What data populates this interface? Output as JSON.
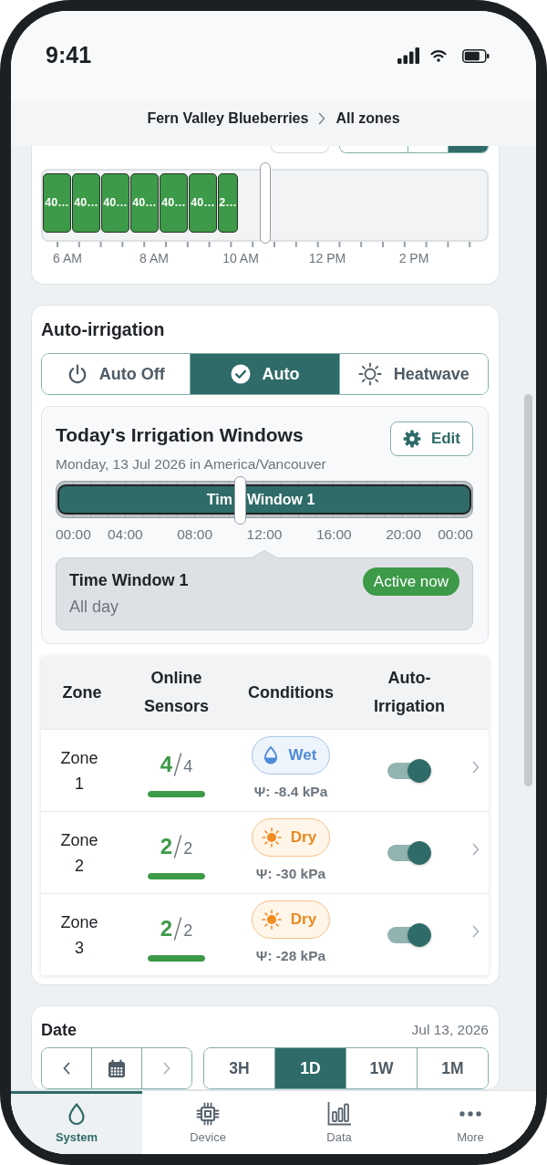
{
  "status_bar": {
    "time": "9:41"
  },
  "breadcrumb": {
    "items": [
      "Fern Valley Blueberries",
      "All zones"
    ]
  },
  "usage_timeline": {
    "range_buttons": [
      {
        "selected": false
      },
      {
        "selected": false
      },
      {
        "selected": true
      }
    ],
    "blocks": [
      {
        "label": "40…"
      },
      {
        "label": "40…"
      },
      {
        "label": "40…"
      },
      {
        "label": "40…"
      },
      {
        "label": "40…"
      },
      {
        "label": "40…"
      },
      {
        "label": "2…"
      }
    ],
    "marker": {
      "level": 0.5
    },
    "axis_labels": [
      "6 AM",
      "8 AM",
      "10 AM",
      "12 PM",
      "2 PM"
    ]
  },
  "auto_irrigation": {
    "title": "Auto-irrigation",
    "modes": [
      {
        "kind": "off",
        "label": "Auto Off",
        "selected": false
      },
      {
        "kind": "auto",
        "label": "Auto",
        "selected": true
      },
      {
        "kind": "heatwave",
        "label": "Heatwave",
        "selected": false
      }
    ],
    "windows": {
      "title": "Today's Irrigation Windows",
      "edit_label": "Edit",
      "date_line": "Monday, 13 Jul 2026 in America/Vancouver",
      "bar_label_parts": [
        "Tim",
        "Window 1"
      ],
      "marker": {
        "level": 0.442
      },
      "axis_labels": [
        "00:00",
        "04:00",
        "08:00",
        "12:00",
        "16:00",
        "20:00",
        "00:00"
      ],
      "popover": {
        "title": "Time Window 1",
        "detail": "All day",
        "badge": "Active now"
      }
    },
    "zone_table": {
      "columns": [
        "Zone",
        "Online Sensors",
        "Conditions",
        "Auto-Irrigation"
      ],
      "rows": [
        {
          "zone": "Zone 1",
          "sensors": {
            "online": "4",
            "total": "4",
            "level": 1
          },
          "condition": {
            "kind": "wet",
            "label": "Wet",
            "reading": "Ψ: -8.4 kPa"
          },
          "auto_irrigation": {
            "on": true
          }
        },
        {
          "zone": "Zone 2",
          "sensors": {
            "online": "2",
            "total": "2",
            "level": 1
          },
          "condition": {
            "kind": "dry",
            "label": "Dry",
            "reading": "Ψ: -30 kPa"
          },
          "auto_irrigation": {
            "on": true
          }
        },
        {
          "zone": "Zone 3",
          "sensors": {
            "online": "2",
            "total": "2",
            "level": 1
          },
          "condition": {
            "kind": "dry",
            "label": "Dry",
            "reading": "Ψ: -28 kPa"
          },
          "auto_irrigation": {
            "on": true
          }
        }
      ]
    }
  },
  "date_panel": {
    "title": "Date",
    "date": "Jul 13, 2026",
    "nav": [
      {
        "kind": "prev",
        "disabled": false
      },
      {
        "kind": "calendar",
        "disabled": false
      },
      {
        "kind": "next",
        "disabled": true
      }
    ],
    "ranges": [
      {
        "label": "3H",
        "selected": false
      },
      {
        "label": "1D",
        "selected": true
      },
      {
        "label": "1W",
        "selected": false
      },
      {
        "label": "1M",
        "selected": false
      }
    ]
  },
  "tab_bar": [
    {
      "kind": "system",
      "label": "System",
      "selected": true
    },
    {
      "kind": "device",
      "label": "Device",
      "selected": false
    },
    {
      "kind": "data",
      "label": "Data",
      "selected": false
    },
    {
      "kind": "more",
      "label": "More",
      "selected": false
    }
  ]
}
